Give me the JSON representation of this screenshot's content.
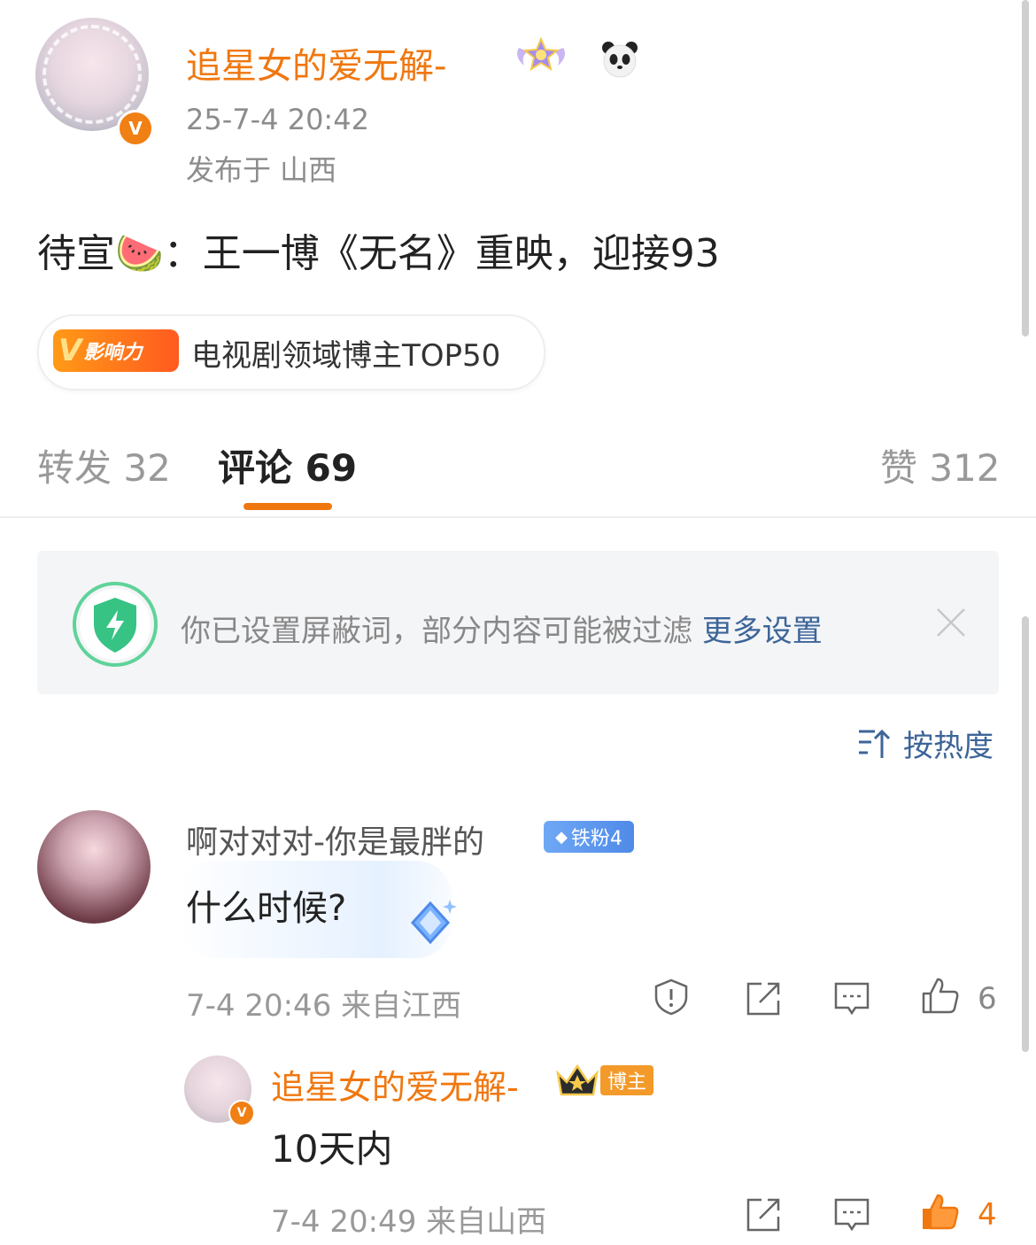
{
  "post": {
    "author_name": "追星女的爱无解-",
    "timestamp": "25-7-4 20:42",
    "location": "发布于 山西",
    "content": "待宣🍉：王一博《无名》重映，迎接93",
    "influence_badge_label": "影响力",
    "influence_badge_letter": "V",
    "influence_text": "电视剧领域博主TOP50"
  },
  "tabs": [
    {
      "label": "转发 32"
    },
    {
      "label": "评论 69"
    },
    {
      "label": "赞 312"
    }
  ],
  "notice": {
    "text": "你已设置屏蔽词，部分内容可能被过滤",
    "link": "更多设置"
  },
  "sort": {
    "label": "按热度"
  },
  "comment": {
    "user": "啊对对对-你是最胖的",
    "fan_badge": "铁粉4",
    "text": "什么时候?",
    "meta": "7-4 20:46 来自江西",
    "likes": "6"
  },
  "reply": {
    "user": "追星女的爱无解-",
    "tag": "博主",
    "text": "10天内",
    "meta": "7-4 20:49 来自山西",
    "likes": "4"
  },
  "colors": {
    "brand_orange": "#f0770f",
    "link_blue": "#3d6598",
    "muted_gray": "#999999"
  },
  "icons": [
    "verified-v-icon",
    "star-wings-badge-icon",
    "panda-icon",
    "shield-bolt-icon",
    "close-icon",
    "sort-icon",
    "report-icon",
    "forward-icon",
    "reply-icon",
    "like-icon",
    "crown-icon",
    "diamond-icon"
  ]
}
